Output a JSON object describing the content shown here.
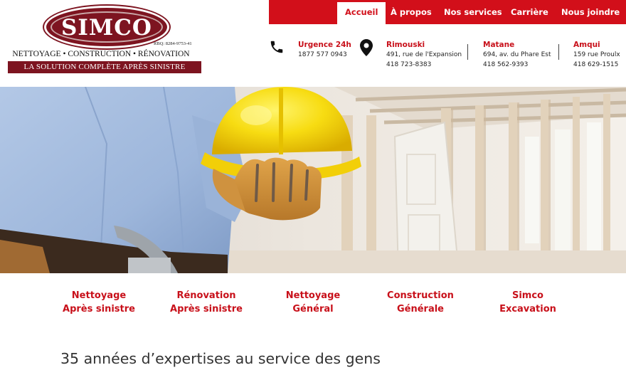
{
  "logo": {
    "name": "SIMCO",
    "rbq": "RBQ: 8284-9753-41",
    "services": "NETTOYAGE • CONSTRUCTION • RÉNOVATION",
    "tagline": "LA SOLUTION COMPLÈTE APRÈS SINISTRE"
  },
  "nav": {
    "items": [
      {
        "label": "Accueil",
        "active": true
      },
      {
        "label": "À propos"
      },
      {
        "label": "Nos services"
      },
      {
        "label": "Carrière"
      },
      {
        "label": "Nous joindre"
      }
    ]
  },
  "contacts": {
    "urgence": {
      "title": "Urgence 24h",
      "phone": "1877 577 0943"
    },
    "rimouski": {
      "title": "Rimouski",
      "address": "491, rue de l'Expansion",
      "phone": "418 723-8383"
    },
    "matane": {
      "title": "Matane",
      "address": "694, av. du Phare Est",
      "phone": "418 562-9393"
    },
    "amqui": {
      "title": "Amqui",
      "address": "159 rue Proulx",
      "phone": "418 629-1515"
    }
  },
  "services": [
    {
      "line1": "Nettoyage",
      "line2": "Après sinistre"
    },
    {
      "line1": "Rénovation",
      "line2": "Après sinistre"
    },
    {
      "line1": "Nettoyage",
      "line2": "Général"
    },
    {
      "line1": "Construction",
      "line2": "Générale"
    },
    {
      "line1": "Simco",
      "line2": "Excavation"
    }
  ],
  "headline": "35 années d’expertises au service des gens",
  "colors": {
    "brand_red": "#d20f1a",
    "logo_burgundy": "#7d1420",
    "text_dark": "#333333"
  },
  "icons": {
    "phone": "phone-icon",
    "location": "map-pin-icon"
  }
}
